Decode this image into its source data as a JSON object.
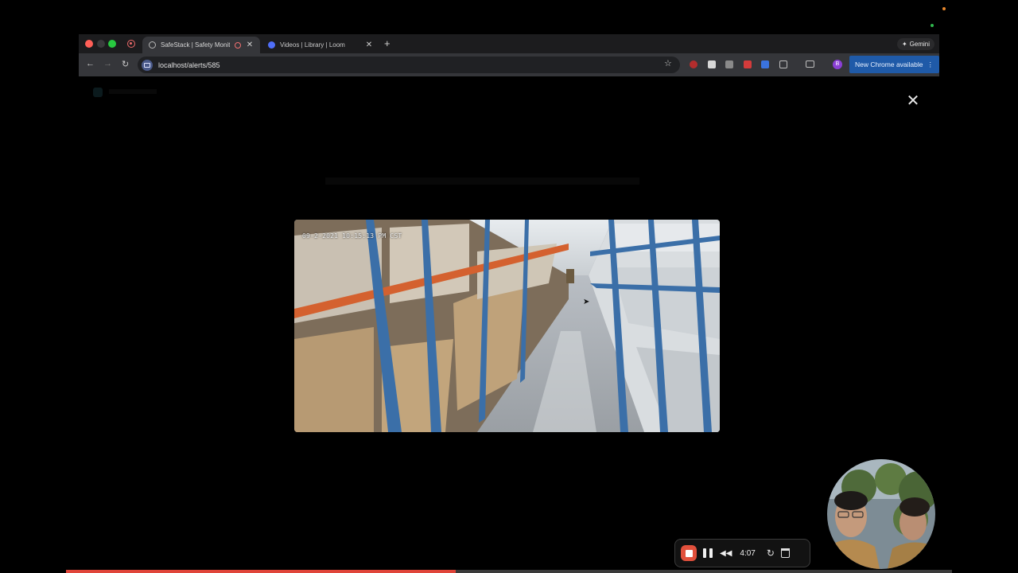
{
  "browser": {
    "tabs": [
      {
        "title": "SafeStack | Safety Monito",
        "active": true,
        "recording": true
      },
      {
        "title": "Videos | Library | Loom",
        "active": false
      }
    ],
    "gemini_label": "Gemini",
    "url": "localhost/alerts/585",
    "update_label": "New Chrome available",
    "profile_initial": "B"
  },
  "video": {
    "timestamp": "09-2-2021 10:15:13 PM CST"
  },
  "recorder": {
    "elapsed": "4:07",
    "progress_fraction": 0.44
  },
  "colors": {
    "record_red": "#e1503c",
    "update_blue": "#1f5aa8",
    "progress_red": "#e0453a"
  },
  "icons": [
    "back-icon",
    "forward-icon",
    "reload-icon",
    "star-icon",
    "close-icon",
    "plus-icon",
    "stop-icon",
    "pause-icon",
    "rewind-icon",
    "restart-icon",
    "trash-icon"
  ]
}
